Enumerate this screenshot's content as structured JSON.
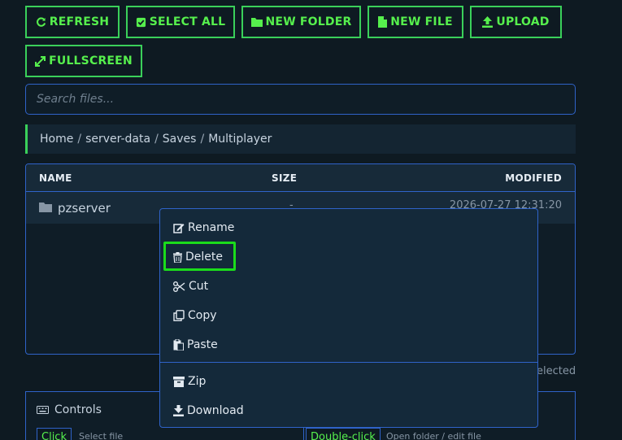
{
  "toolbar": {
    "refresh": "REFRESH",
    "select_all": "SELECT ALL",
    "new_folder": "NEW FOLDER",
    "new_file": "NEW FILE",
    "upload": "UPLOAD",
    "fullscreen": "FULLSCREEN"
  },
  "search": {
    "placeholder": "Search files..."
  },
  "breadcrumb": [
    "Home",
    "server-data",
    "Saves",
    "Multiplayer"
  ],
  "table": {
    "headers": {
      "name": "NAME",
      "size": "SIZE",
      "modified": "MODIFIED"
    },
    "rows": [
      {
        "name": "pzserver",
        "size": "-",
        "modified": "2026-07-27 12:31:20"
      }
    ]
  },
  "status": {
    "selected_text": "elected"
  },
  "controls": {
    "title": "Controls",
    "items": [
      {
        "key": "Click",
        "desc": "Select file"
      },
      {
        "key": "Double-click",
        "desc": "Open folder / edit file"
      }
    ]
  },
  "context_menu": {
    "rename": "Rename",
    "delete": "Delete",
    "cut": "Cut",
    "copy": "Copy",
    "paste": "Paste",
    "zip": "Zip",
    "download": "Download"
  },
  "colors": {
    "accent_green": "#56f04d",
    "border_blue": "#2f63c9",
    "highlight_green": "#1bdc1b"
  },
  "icons": {
    "refresh": "refresh-icon",
    "select_all": "checkbox-icon",
    "new_folder": "folder-icon",
    "new_file": "file-icon",
    "upload": "upload-icon",
    "fullscreen": "expand-icon",
    "folder_row": "folder-icon",
    "controls": "keyboard-icon",
    "rename": "edit-icon",
    "delete": "trash-icon",
    "cut": "scissors-icon",
    "copy": "copy-icon",
    "paste": "clipboard-icon",
    "zip": "archive-icon",
    "download": "download-icon"
  }
}
